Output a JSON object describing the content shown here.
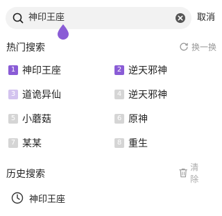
{
  "search": {
    "value": "神印王座",
    "cancel_label": "取消"
  },
  "hot": {
    "title": "热门搜索",
    "refresh_label": "换一换",
    "items": [
      {
        "rank": "1",
        "label": "神印王座"
      },
      {
        "rank": "2",
        "label": "逆天邪神"
      },
      {
        "rank": "3",
        "label": "道诡异仙"
      },
      {
        "rank": "4",
        "label": "逆天邪神"
      },
      {
        "rank": "5",
        "label": "小蘑菇"
      },
      {
        "rank": "6",
        "label": "原神"
      },
      {
        "rank": "7",
        "label": "某某"
      },
      {
        "rank": "8",
        "label": "重生"
      }
    ]
  },
  "history": {
    "title": "历史搜索",
    "clear_label": "清除",
    "items": [
      {
        "label": "神印王座"
      }
    ]
  },
  "colors": {
    "accent": "#8a5cd6",
    "accent_light": "#d3c3ef",
    "rank_gray": "#d5d5d5",
    "search_bg": "#f2f2f2"
  }
}
